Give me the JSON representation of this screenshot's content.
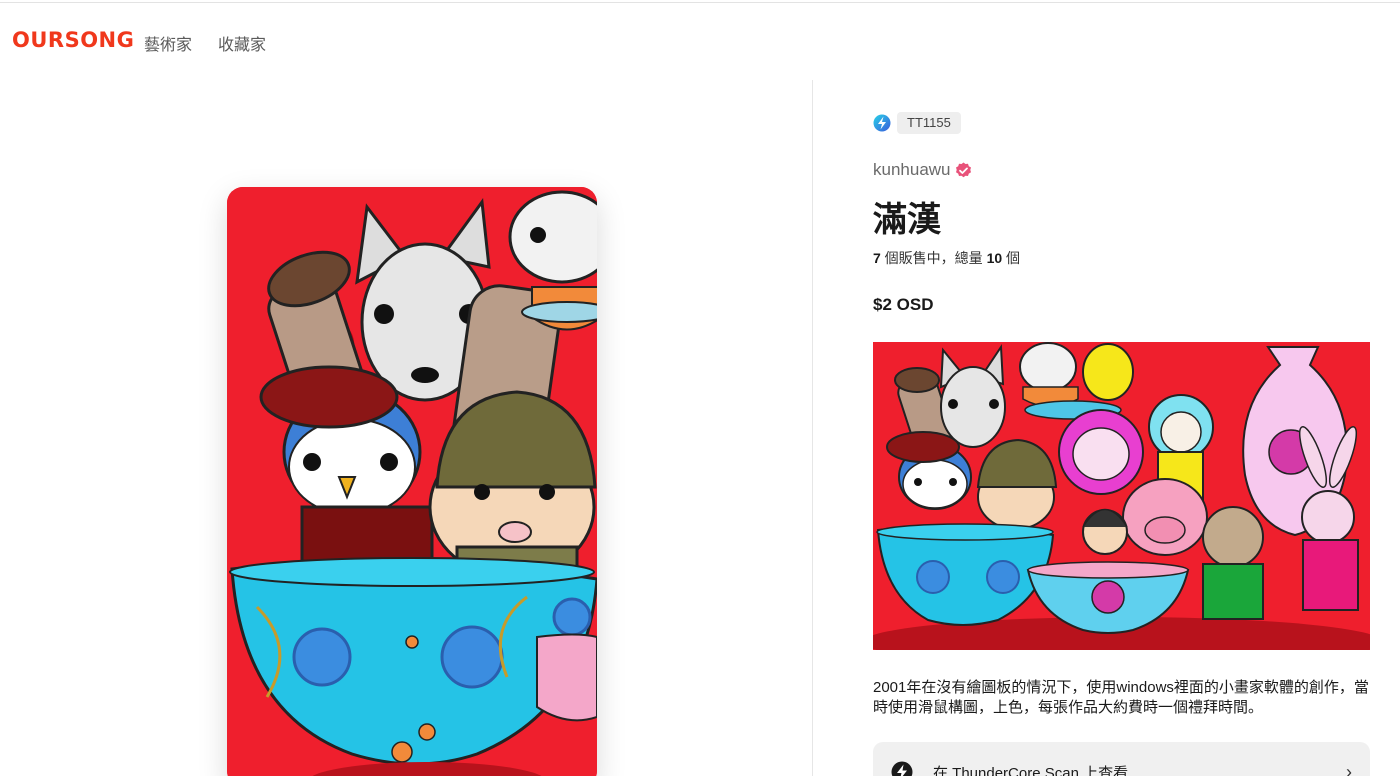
{
  "header": {
    "logo": "OURSONG",
    "nav": [
      {
        "label": "藝術家"
      },
      {
        "label": "收藏家"
      }
    ]
  },
  "artwork": {
    "image_icon": "artwork-image",
    "chain_icon": "thundercore-icon",
    "token_id": "TT1155",
    "artist": "kunhuawu",
    "verified_icon": "verified-badge-icon",
    "title": "滿漢",
    "editions": {
      "available": "7",
      "available_label": " 個販售中，總量 ",
      "total": "10",
      "total_label": " 個"
    },
    "price": "$2 OSD",
    "description": "2001年在沒有繪圖板的情況下，使用windows裡面的小畫家軟體的創作，當時使用滑鼠構圖，上色，每張作品大約費時一個禮拜時間。",
    "scan_link": {
      "icon": "thundercore-scan-icon",
      "label": "在 ThunderCore Scan 上查看",
      "chevron": "›"
    }
  },
  "colors": {
    "brand": "#f0381c",
    "artwork_background": "#ef1f2d",
    "verified": "#e8527a"
  }
}
